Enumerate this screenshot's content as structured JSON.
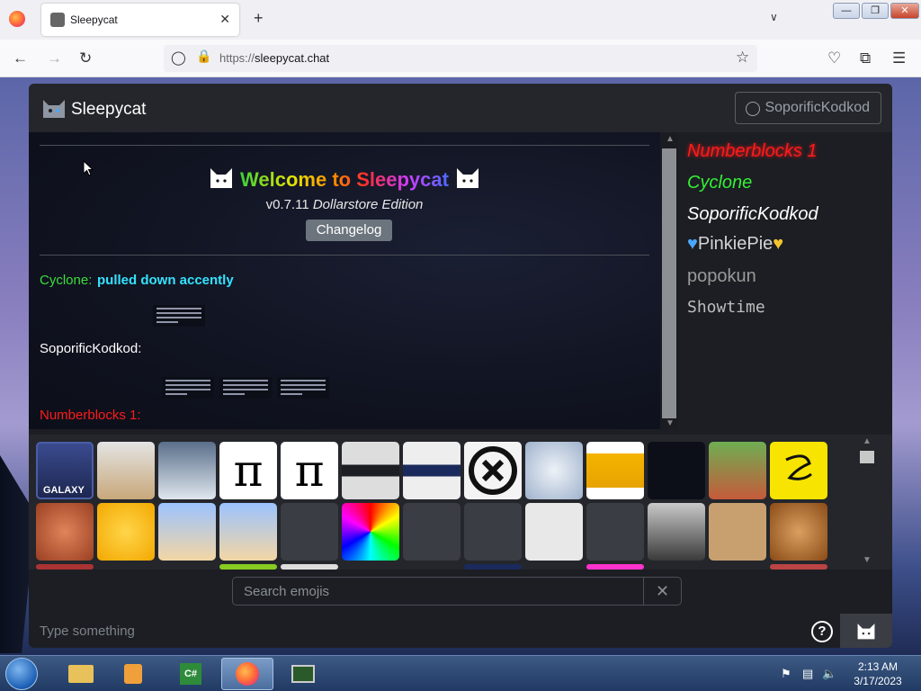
{
  "browser": {
    "tab_title": "Sleepycat",
    "tab_close": "✕",
    "new_tab": "+",
    "url_protocol": "https://",
    "url_host": "sleepycat.chat"
  },
  "app": {
    "brand": "Sleepycat",
    "current_user": "SoporificKodkod"
  },
  "chat": {
    "welcome": "Welcome to Sleepycat",
    "version": "v0.7.11",
    "edition": "Dollarstore Edition",
    "changelog_label": "Changelog",
    "messages": [
      {
        "author": "Cyclone:",
        "text": "pulled down accently",
        "author_color": "#3ddc3d",
        "text_color": "#34e3ff"
      },
      {
        "author": "SoporificKodkod:",
        "text": "",
        "author_color": "#ffffff"
      },
      {
        "author": "Numberblocks 1:",
        "text": "",
        "author_color": "#ff1a1a"
      }
    ]
  },
  "users": [
    {
      "name": "Numberblocks 1",
      "color": "#ff1a1a"
    },
    {
      "name": "Cyclone",
      "color": "#35f035"
    },
    {
      "name": "SoporificKodkod",
      "color": "#ffffff"
    },
    {
      "name": "PinkiePie",
      "color": "#d4d4d4"
    },
    {
      "name": "popokun",
      "color": "#9a9a9a"
    },
    {
      "name": "Showtime",
      "color": "#bdbdbd"
    }
  ],
  "emoji_panel": {
    "search_placeholder": "Search emojis",
    "clear": "✕",
    "row1_captions": [
      "GALAXY"
    ]
  },
  "composer": {
    "placeholder": "Type something",
    "help": "?"
  },
  "taskbar": {
    "time": "2:13 AM",
    "date": "3/17/2023"
  }
}
